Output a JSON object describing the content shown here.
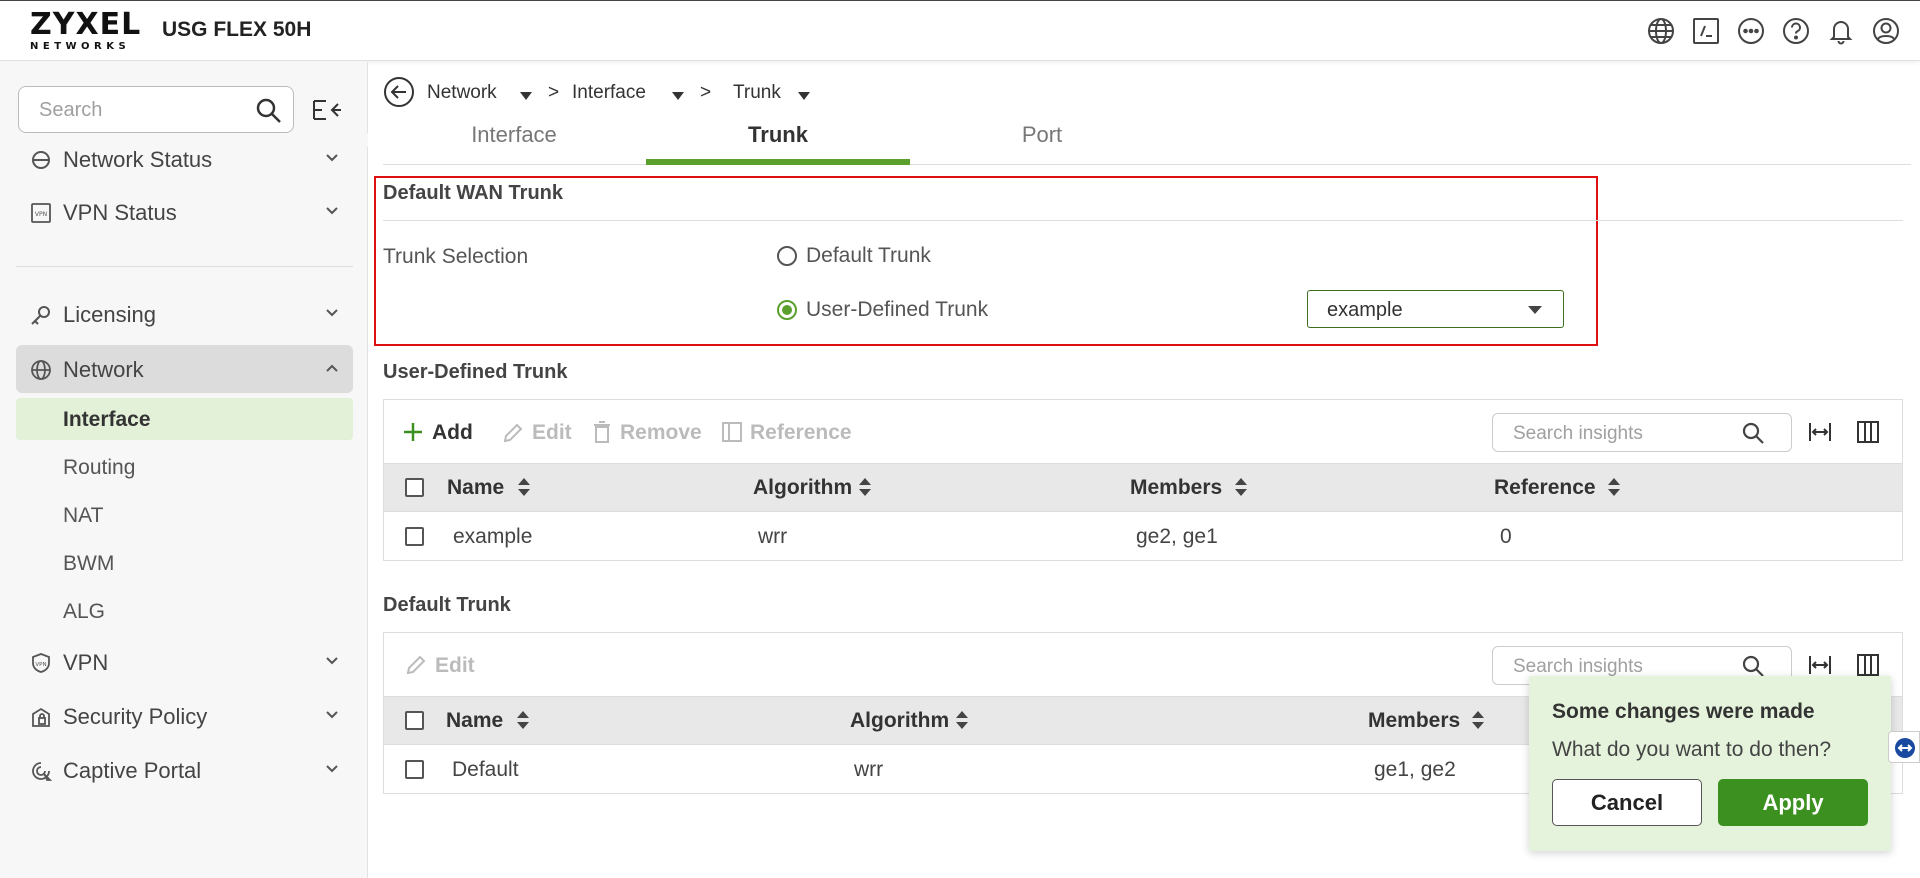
{
  "brand": {
    "logo_main": "ZYXEL",
    "logo_sub": "NETWORKS",
    "product": "USG FLEX 50H"
  },
  "topbar_icons": [
    "globe-icon",
    "terminal-icon",
    "more-icon",
    "help-icon",
    "bell-icon",
    "user-icon"
  ],
  "sidebar": {
    "search_placeholder": "Search",
    "items": [
      {
        "label": "Network Status",
        "icon": "network-status-icon",
        "expanded": false
      },
      {
        "label": "VPN Status",
        "icon": "vpn-status-icon",
        "expanded": false
      },
      {
        "label": "Licensing",
        "icon": "key-icon",
        "expanded": false
      },
      {
        "label": "Network",
        "icon": "globe-icon",
        "expanded": true
      },
      {
        "label": "VPN",
        "icon": "shield-icon",
        "expanded": false
      },
      {
        "label": "Security Policy",
        "icon": "security-policy-icon",
        "expanded": false
      },
      {
        "label": "Captive Portal",
        "icon": "captive-portal-icon",
        "expanded": false
      }
    ],
    "network_sub": [
      "Interface",
      "Routing",
      "NAT",
      "BWM",
      "ALG"
    ],
    "active_sub": "Interface"
  },
  "breadcrumb": [
    "Network",
    ">",
    "Interface",
    ">",
    "Trunk"
  ],
  "tabs": [
    "Interface",
    "Trunk",
    "Port"
  ],
  "active_tab": "Trunk",
  "default_wan": {
    "title": "Default WAN Trunk",
    "selection_label": "Trunk Selection",
    "option_default": "Default Trunk",
    "option_user": "User-Defined Trunk",
    "selected_option": "User-Defined Trunk",
    "select_value": "example"
  },
  "user_defined": {
    "title": "User-Defined Trunk",
    "toolbar": {
      "add": "Add",
      "edit": "Edit",
      "remove": "Remove",
      "reference": "Reference"
    },
    "search_placeholder": "Search insights",
    "columns": [
      "Name",
      "Algorithm",
      "Members",
      "Reference"
    ],
    "rows": [
      {
        "name": "example",
        "algorithm": "wrr",
        "members": "ge2, ge1",
        "reference": "0"
      }
    ]
  },
  "default_trunk": {
    "title": "Default Trunk",
    "toolbar": {
      "edit": "Edit"
    },
    "search_placeholder": "Search insights",
    "columns": [
      "Name",
      "Algorithm",
      "Members"
    ],
    "rows": [
      {
        "name": "Default",
        "algorithm": "wrr",
        "members": "ge1, ge2"
      }
    ]
  },
  "toast": {
    "title": "Some changes were made",
    "message": "What do you want to do then?",
    "cancel": "Cancel",
    "apply": "Apply"
  },
  "colors": {
    "accent_green": "#5ba02c",
    "apply_green": "#3b9020",
    "highlight_red": "#e01010",
    "active_sub_bg": "#e3f1d8"
  }
}
